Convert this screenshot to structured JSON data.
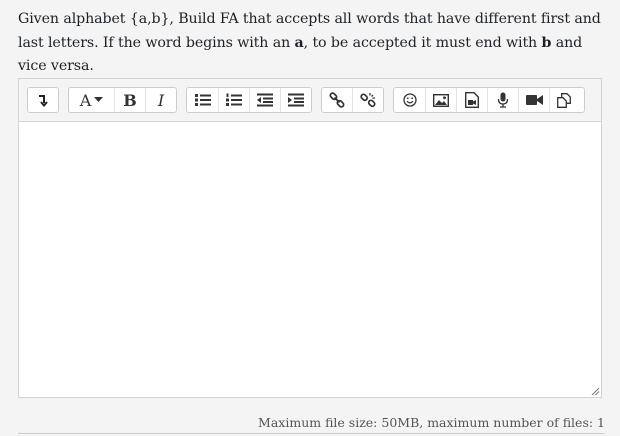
{
  "question": {
    "part1": "Given alphabet {a,b}, Build FA that accepts all words that have different first and last letters. If the word begins with an ",
    "bold1": "a",
    "part2": ", to be accepted it must end with ",
    "bold2": "b",
    "part3": " and vice versa."
  },
  "toolbar": {
    "toggle_icon": "toolbar-toggle-icon",
    "font_style_label": "A",
    "bold_label": "B",
    "italic_label": "I",
    "icons": [
      "unordered-list-icon",
      "ordered-list-icon",
      "outdent-icon",
      "indent-icon",
      "link-icon",
      "unlink-icon",
      "emoticon-icon",
      "image-icon",
      "media-icon",
      "record-audio-icon",
      "record-video-icon",
      "manage-files-icon"
    ]
  },
  "editor": {
    "content": ""
  },
  "footer": {
    "file_limits": "Maximum file size: 50MB, maximum number of files: 1"
  }
}
